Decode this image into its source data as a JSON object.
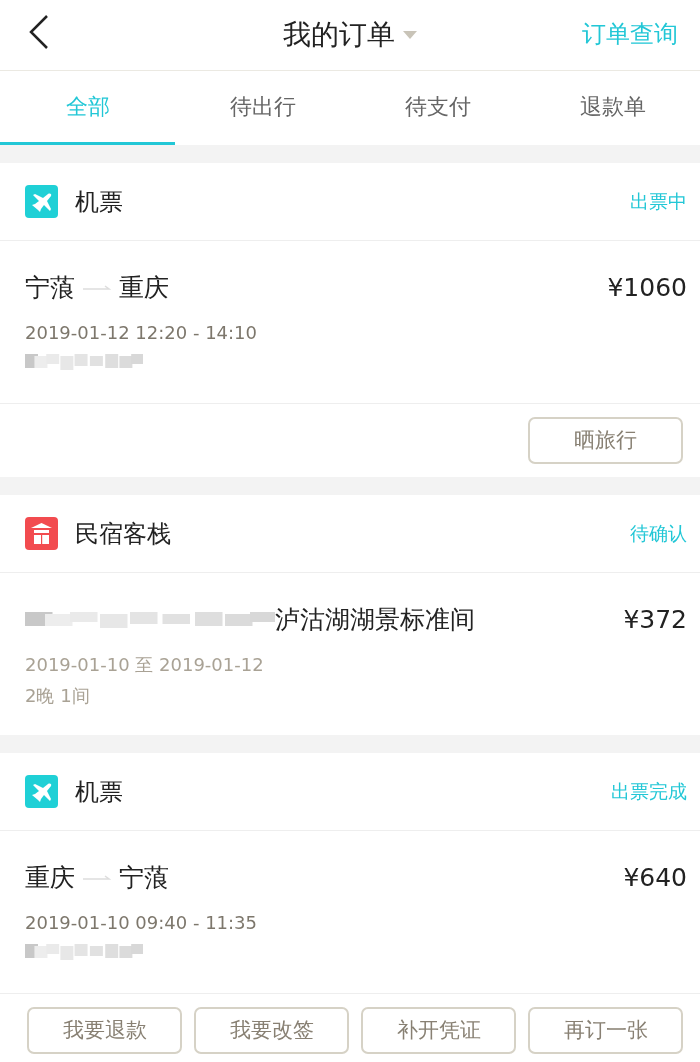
{
  "header": {
    "title": "我的订单",
    "dropdown": true,
    "action": "订单查询"
  },
  "tabs": [
    {
      "label": "全部",
      "selected": true
    },
    {
      "label": "待出行",
      "selected": false
    },
    {
      "label": "待支付",
      "selected": false
    },
    {
      "label": "退款单",
      "selected": false
    }
  ],
  "orders": [
    {
      "kind": "flight",
      "category": "机票",
      "status": "出票中",
      "from": "宁蒗",
      "to": "重庆",
      "price": "¥1060",
      "lines": [
        "2019-01-12 12:20 - 14:10"
      ],
      "masked": true,
      "buttons": [
        "晒旅行"
      ]
    },
    {
      "kind": "homestay",
      "category": "民宿客栈",
      "status": "待确认",
      "name": "泸沽湖湖景标准间",
      "price": "¥372",
      "lines": [
        "2019-01-10 至 2019-01-12",
        "2晚 1间"
      ],
      "masked": true
    },
    {
      "kind": "flight",
      "category": "机票",
      "status": "出票完成",
      "from": "重庆",
      "to": "宁蒗",
      "price": "¥640",
      "lines": [
        "2019-01-10 09:40 - 11:35"
      ],
      "masked": true,
      "buttons": [
        "我要退款",
        "我要改签",
        "补开凭证",
        "再订一张"
      ]
    }
  ]
}
